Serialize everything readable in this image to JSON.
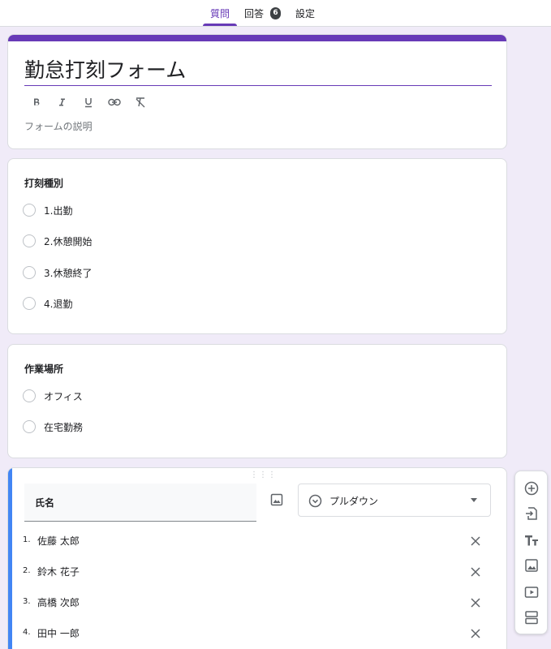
{
  "tabs": {
    "questions": "質問",
    "responses": "回答",
    "responses_count": "6",
    "settings": "設定"
  },
  "form": {
    "title": "勤怠打刻フォーム",
    "description_placeholder": "フォームの説明"
  },
  "question1": {
    "title": "打刻種別",
    "options": [
      "1.出勤",
      "2.休憩開始",
      "3.休憩終了",
      "4.退勤"
    ]
  },
  "question2": {
    "title": "作業場所",
    "options": [
      "オフィス",
      "在宅勤務"
    ]
  },
  "question3": {
    "title": "氏名",
    "type": "プルダウン",
    "items": [
      {
        "num": "1.",
        "label": "佐藤 太郎"
      },
      {
        "num": "2.",
        "label": "鈴木 花子"
      },
      {
        "num": "3.",
        "label": "高橋 次郎"
      },
      {
        "num": "4.",
        "label": "田中 一郎"
      }
    ]
  },
  "colors": {
    "accent": "#673ab7",
    "active_question": "#4285f4",
    "background": "#f0ebf8"
  }
}
